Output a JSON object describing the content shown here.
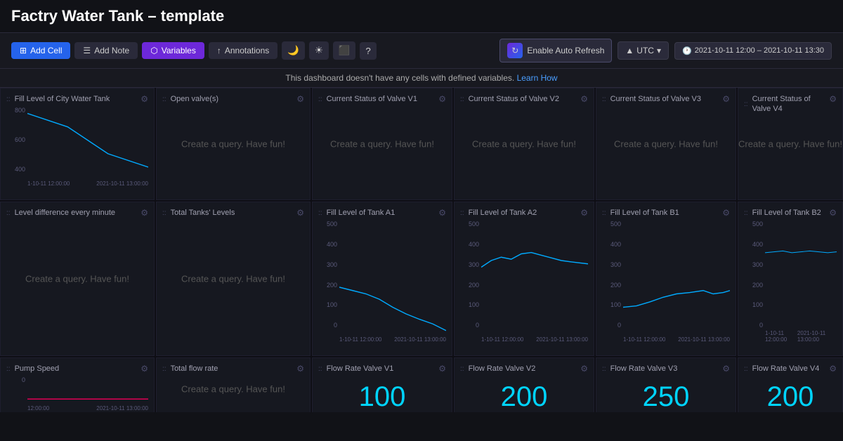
{
  "header": {
    "title": "Factry Water Tank – template"
  },
  "toolbar": {
    "add_cell": "Add Cell",
    "add_note": "Add Note",
    "variables": "Variables",
    "annotations": "Annotations",
    "help_label": "?",
    "refresh_label": "Enable Auto Refresh",
    "utc_label": "UTC",
    "date_range": "2021-10-11 12:00 – 2021-10-11 13:30"
  },
  "info_bar": {
    "text": "This dashboard doesn't have any cells with defined variables.",
    "link": "Learn How"
  },
  "cells": [
    {
      "id": "fill-city",
      "title": "Fill Level of City Water Tank",
      "type": "line-chart",
      "y_vals": [
        "800",
        "600",
        "400"
      ],
      "x_vals": [
        "1-10-11 12:00:00",
        "2021-10-11 13:00:00"
      ]
    },
    {
      "id": "open-valves",
      "title": "Open valve(s)",
      "type": "placeholder"
    },
    {
      "id": "valve-v1",
      "title": "Current Status of Valve V1",
      "type": "placeholder"
    },
    {
      "id": "valve-v2",
      "title": "Current Status of Valve V2",
      "type": "placeholder"
    },
    {
      "id": "valve-v3",
      "title": "Current Status of Valve V3",
      "type": "placeholder"
    },
    {
      "id": "valve-v4",
      "title": "Current Status of Valve V4",
      "type": "placeholder"
    },
    {
      "id": "level-diff",
      "title": "Level difference every minute",
      "type": "placeholder"
    },
    {
      "id": "total-tanks",
      "title": "Total Tanks' Levels",
      "type": "placeholder"
    },
    {
      "id": "tank-a1",
      "title": "Fill Level of Tank A1",
      "type": "line-chart-b",
      "y_vals": [
        "500",
        "400",
        "300",
        "200",
        "100",
        "0"
      ],
      "x_vals": [
        "1-10-11 12:00:00",
        "2021-10-11 13:00:00"
      ]
    },
    {
      "id": "tank-a2",
      "title": "Fill Level of Tank A2",
      "type": "line-chart-c",
      "y_vals": [
        "500",
        "400",
        "300",
        "200",
        "100",
        "0"
      ],
      "x_vals": [
        "1-10-11 12:00:00",
        "2021-10-11 13:00:00"
      ]
    },
    {
      "id": "tank-b1",
      "title": "Fill Level of Tank B1",
      "type": "line-chart-d",
      "y_vals": [
        "500",
        "400",
        "300",
        "200",
        "100",
        "0"
      ],
      "x_vals": [
        "1-10-11 12:00:00",
        "2021-10-11 13:00:00"
      ]
    },
    {
      "id": "tank-b2",
      "title": "Fill Level of Tank B2",
      "type": "line-chart-e",
      "y_vals": [
        "500",
        "400",
        "300",
        "200",
        "100",
        "0"
      ],
      "x_vals": [
        "1-10-11 12:00:00",
        "2021-10-11 13:00:00"
      ]
    },
    {
      "id": "pump-speed",
      "title": "Pump Speed",
      "type": "line-red",
      "y_vals": [
        "0"
      ],
      "x_vals": [
        "12:00:00",
        "2021-10-11 13:00:00"
      ]
    },
    {
      "id": "total-flow",
      "title": "Total flow rate",
      "type": "placeholder"
    },
    {
      "id": "flow-v1",
      "title": "Flow Rate Valve V1",
      "type": "big-number",
      "value": "100"
    },
    {
      "id": "flow-v2",
      "title": "Flow Rate Valve V2",
      "type": "big-number",
      "value": "200"
    },
    {
      "id": "flow-v3",
      "title": "Flow Rate Valve V3",
      "type": "big-number",
      "value": "250"
    },
    {
      "id": "flow-v4",
      "title": "Flow Rate Valve V4",
      "type": "big-number",
      "value": "200"
    }
  ],
  "placeholder_text": "Create a query. Have fun!"
}
